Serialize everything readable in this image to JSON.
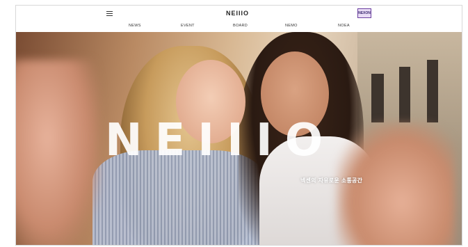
{
  "header": {
    "logo_text": "NEIIIO",
    "menu_icon": "hamburger-menu-icon",
    "badge": {
      "top": "NEXON",
      "bottom": ""
    },
    "nav": [
      "NEWS",
      "EVENT",
      "BOARD",
      "NEMO",
      "NOEA"
    ]
  },
  "hero": {
    "brand_mark": "NEIIIO",
    "tagline": "넥센의 자유로운 소통공간"
  },
  "colors": {
    "badge_border": "#6b3fa0",
    "badge_fill": "#e9dcf5"
  }
}
